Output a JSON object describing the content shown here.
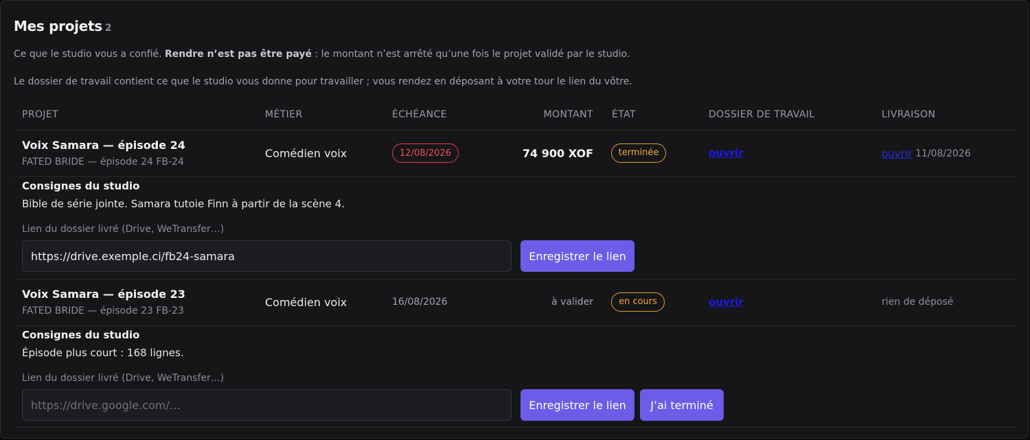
{
  "header": {
    "title": "Mes projets",
    "count": "2",
    "intro_prefix": "Ce que le studio vous a confié. ",
    "intro_bold": "Rendre n’est pas être payé",
    "intro_suffix": " : le montant n’est arrêté qu’une fois le projet validé par le studio.",
    "intro_2": "Le dossier de travail contient ce que le studio vous donne pour travailler ; vous rendez en déposant à votre tour le lien du vôtre."
  },
  "columns": [
    "PROJET",
    "MÉTIER",
    "ÉCHÉANCE",
    "MONTANT",
    "ÉTAT",
    "DOSSIER DE TRAVAIL",
    "LIVRAISON"
  ],
  "projects": [
    {
      "name": "Voix Samara — épisode 24",
      "subtitle": "FATED BRIDE — épisode 24 FB-24",
      "role": "Comédien voix",
      "deadline": "12/08/2026",
      "amount": "74 900 XOF",
      "status": "terminée",
      "workfolder": "ouvrir",
      "delivery_link": "ouvrir",
      "delivery_date": "11/08/2026",
      "notes_title": "Consignes du studio",
      "notes": "Bible de série jointe. Samara tutoie Finn à partir de la scène 4.",
      "field_label": "Lien du dossier livré (Drive, WeTransfer…)",
      "field_value": "https://drive.exemple.ci/fb24-samara",
      "save_label": "Enregistrer le lien"
    },
    {
      "name": "Voix Samara — épisode 23",
      "subtitle": "FATED BRIDE — épisode 23 FB-23",
      "role": "Comédien voix",
      "deadline": "16/08/2026",
      "amount": "à valider",
      "status": "en cours",
      "workfolder": "ouvrir",
      "delivery_none": "rien de déposé",
      "notes_title": "Consignes du studio",
      "notes": "Épisode plus court : 168 lignes.",
      "field_label": "Lien du dossier livré (Drive, WeTransfer…)",
      "field_placeholder": "https://drive.google.com/…",
      "save_label": "Enregistrer le lien",
      "done_label": "J’ai terminé"
    }
  ],
  "colors": {
    "accent": "#6c5ce7",
    "deadline_overdue": "#ef5350",
    "status_warn": "#f0ab41",
    "link": "#1b1be6"
  }
}
